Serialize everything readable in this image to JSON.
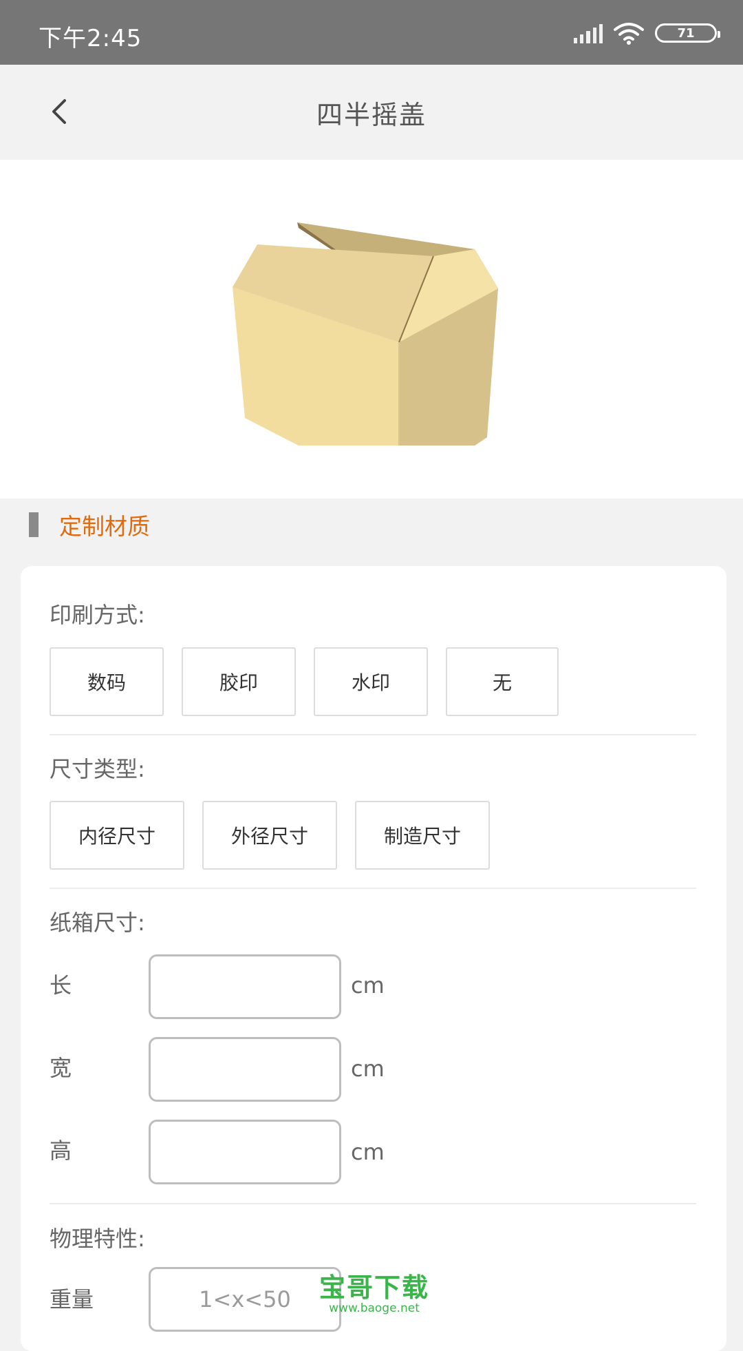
{
  "status_bar": {
    "time": "下午2:45",
    "battery": "71"
  },
  "header": {
    "title": "四半摇盖"
  },
  "section": {
    "title": "定制材质"
  },
  "printing": {
    "label": "印刷方式:",
    "options": [
      "数码",
      "胶印",
      "水印",
      "无"
    ]
  },
  "size_type": {
    "label": "尺寸类型:",
    "options": [
      "内径尺寸",
      "外径尺寸",
      "制造尺寸"
    ]
  },
  "box_size": {
    "label": "纸箱尺寸:",
    "fields": [
      {
        "label": "长",
        "unit": "cm",
        "value": ""
      },
      {
        "label": "宽",
        "unit": "cm",
        "value": ""
      },
      {
        "label": "高",
        "unit": "cm",
        "value": ""
      }
    ]
  },
  "physical": {
    "label": "物理特性:",
    "weight_label": "重量",
    "weight_placeholder": "1<x<50"
  },
  "watermark": {
    "main": "宝哥下载",
    "sub": "www.baoge.net"
  },
  "colors": {
    "accent": "#e26a0a",
    "status_bar": "#767676",
    "box_light": "#f3dfa4",
    "box_dark": "#b9a573"
  }
}
